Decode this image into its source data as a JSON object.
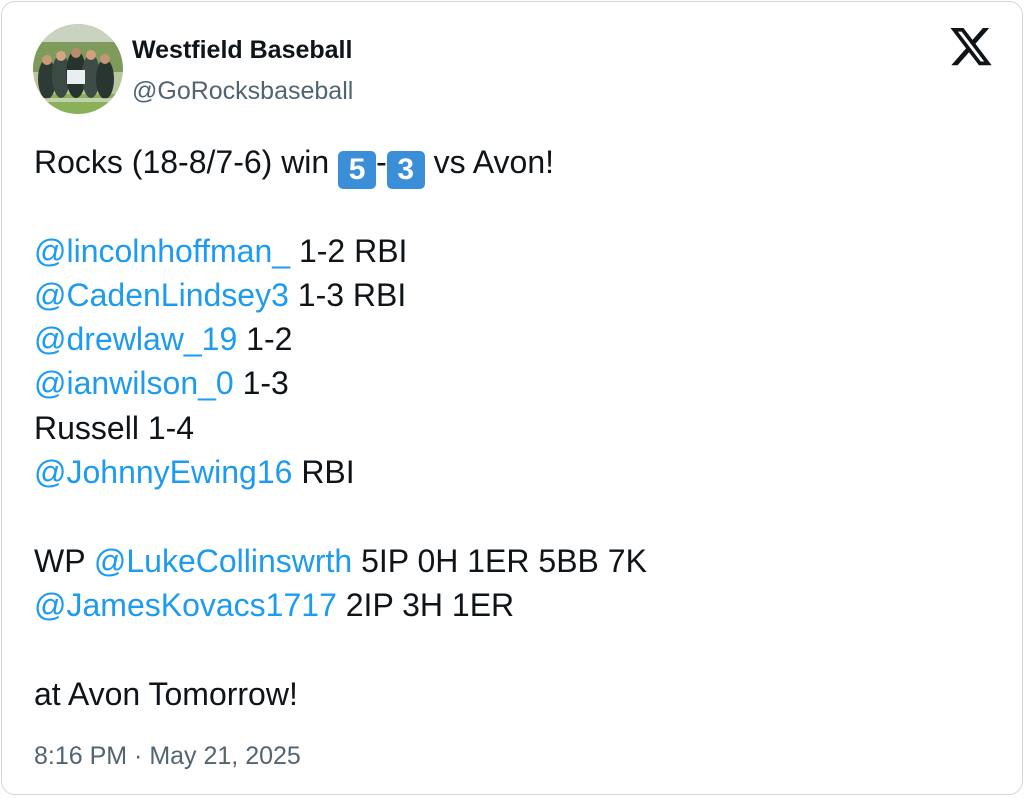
{
  "author": {
    "display_name": "Westfield Baseball",
    "handle": "@GoRocksbaseball"
  },
  "tweet": {
    "line1": {
      "prefix": "Rocks (18-8/7-6) win ",
      "score_home": "5",
      "dash": "-",
      "score_away": "3",
      "suffix": " vs Avon!"
    },
    "batters": [
      {
        "mention": "@lincolnhoffman_",
        "stat": " 1-2 RBI"
      },
      {
        "mention": "@CadenLindsey3",
        "stat": " 1-3 RBI"
      },
      {
        "mention": "@drewlaw_19",
        "stat": " 1-2"
      },
      {
        "mention": "@ianwilson_0",
        "stat": " 1-3"
      },
      {
        "plain": "Russell 1-4"
      },
      {
        "mention": "@JohnnyEwing16",
        "stat": " RBI"
      }
    ],
    "pitchers": [
      {
        "prefix": "WP ",
        "mention": "@LukeCollinswrth",
        "stat": " 5IP 0H 1ER 5BB 7K"
      },
      {
        "mention": "@JamesKovacs1717",
        "stat": " 2IP 3H 1ER"
      }
    ],
    "closing": "at Avon Tomorrow!"
  },
  "timestamp": "8:16 PM · May 21, 2025",
  "icons": {
    "brand": "x-logo-icon",
    "keycap": "keycap-digit-icon"
  },
  "colors": {
    "mention": "#1d9bf0",
    "secondary_text": "#536471",
    "keycap": "#3b8fd8",
    "border": "#cfd9de"
  }
}
